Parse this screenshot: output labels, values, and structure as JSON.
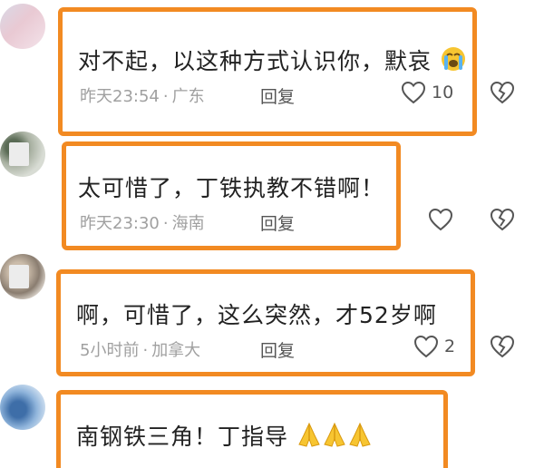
{
  "comments": [
    {
      "text": "对不起，以这种方式认识你，默哀",
      "time": "昨天23:54",
      "separator": "·",
      "location": "广东",
      "reply": "回复",
      "likes": "10"
    },
    {
      "text": "太可惜了，丁铁执教不错啊！",
      "time": "昨天23:30",
      "separator": "·",
      "location": "海南",
      "reply": "回复",
      "likes": ""
    },
    {
      "text": "啊，可惜了，这么突然，才52岁啊",
      "time": "5小时前",
      "separator": "·",
      "location": "加拿大",
      "reply": "回复",
      "likes": "2"
    },
    {
      "text": "南钢铁三角！丁指导",
      "time": "",
      "separator": "",
      "location": "",
      "reply": "",
      "likes": ""
    }
  ],
  "icons": {
    "like": "heart-outline-icon",
    "dislike": "broken-heart-icon",
    "crying": "loudly-crying-face-emoji",
    "folded_hands": "folded-hands-emoji"
  },
  "colors": {
    "highlight_border": "#f28a22",
    "meta_text": "#a0a0a0",
    "body_text": "#222222"
  }
}
